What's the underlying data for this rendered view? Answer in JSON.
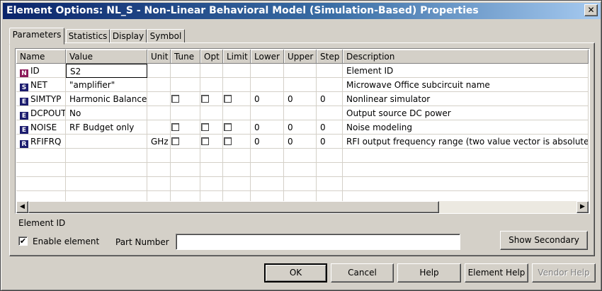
{
  "window": {
    "title": "Element Options: NL_S - Non-Linear Behavioral Model (Simulation-Based) Properties",
    "close_glyph": "✕"
  },
  "tabs": [
    {
      "label": "Parameters"
    },
    {
      "label": "Statistics"
    },
    {
      "label": "Display"
    },
    {
      "label": "Symbol"
    }
  ],
  "table": {
    "columns": [
      "Name",
      "Value",
      "Unit",
      "Tune",
      "Opt",
      "Limit",
      "Lower",
      "Upper",
      "Step",
      "Description"
    ],
    "rows": [
      {
        "badge": "N",
        "name": "ID",
        "value": "S2",
        "unit": "",
        "tune": null,
        "opt": null,
        "limit": null,
        "lower": "",
        "upper": "",
        "step": "",
        "description": "Element ID"
      },
      {
        "badge": "S",
        "name": "NET",
        "value": "\"amplifier\"",
        "unit": "",
        "tune": null,
        "opt": null,
        "limit": null,
        "lower": "",
        "upper": "",
        "step": "",
        "description": "Microwave Office subcircuit name"
      },
      {
        "badge": "E",
        "name": "SIMTYP",
        "value": "Harmonic Balance",
        "unit": "",
        "tune": false,
        "opt": false,
        "limit": false,
        "lower": "0",
        "upper": "0",
        "step": "0",
        "description": "Nonlinear simulator"
      },
      {
        "badge": "E",
        "name": "DCPOUT",
        "value": "No",
        "unit": "",
        "tune": null,
        "opt": null,
        "limit": null,
        "lower": "",
        "upper": "",
        "step": "",
        "description": "Output source DC power"
      },
      {
        "badge": "E",
        "name": "NOISE",
        "value": "RF Budget only",
        "unit": "",
        "tune": false,
        "opt": false,
        "limit": false,
        "lower": "0",
        "upper": "0",
        "step": "0",
        "description": "Noise modeling"
      },
      {
        "badge": "R",
        "name": "RFIFRQ",
        "value": "",
        "unit": "GHz",
        "tune": false,
        "opt": false,
        "limit": false,
        "lower": "0",
        "upper": "0",
        "step": "0",
        "description": "RFI output frequency range (two value vector is absolute ran"
      }
    ]
  },
  "scroll": {
    "left_glyph": "◀",
    "right_glyph": "▶"
  },
  "footer": {
    "selected_description": "Element ID",
    "enable_label": "Enable element",
    "enable_checked_glyph": "✔",
    "part_number_label": "Part Number",
    "part_number_value": "",
    "show_secondary": "Show Secondary"
  },
  "buttons": {
    "ok": "OK",
    "cancel": "Cancel",
    "help": "Help",
    "element_help": "Element Help",
    "vendor_help": "Vendor Help"
  }
}
